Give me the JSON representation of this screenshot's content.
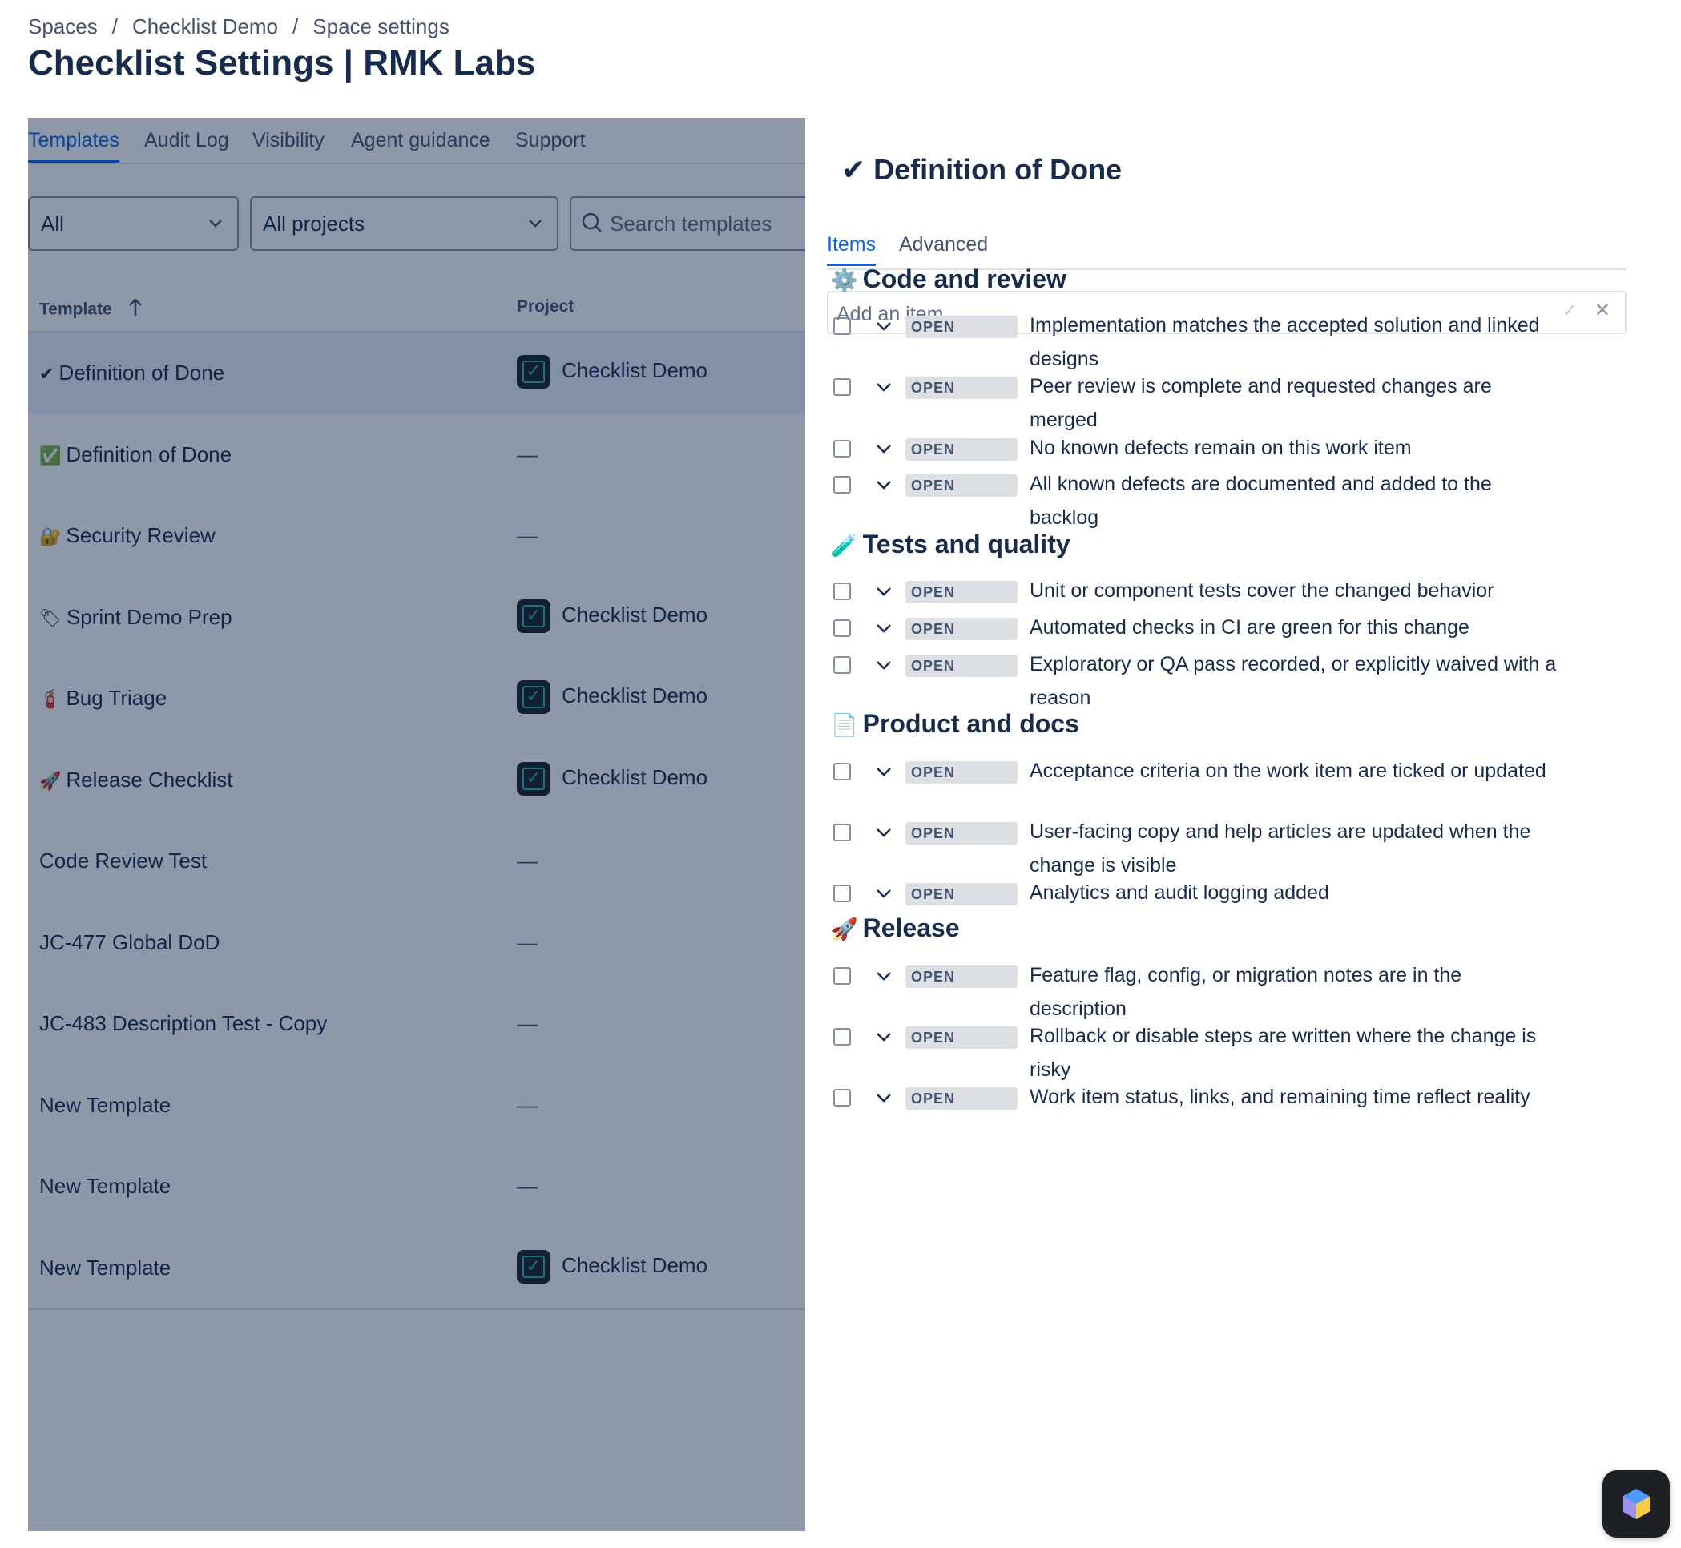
{
  "breadcrumb": {
    "items": [
      "Spaces",
      "Checklist Demo",
      "Space settings"
    ],
    "separator": "/"
  },
  "page": {
    "title": "Checklist Settings | RMK Labs"
  },
  "tabs": [
    "Templates",
    "Audit Log",
    "Visibility",
    "Agent guidance",
    "Support"
  ],
  "active_tab": "Templates",
  "filters": {
    "type_value": "All",
    "project_value": "All projects",
    "search_placeholder": "Search templates"
  },
  "table": {
    "columns": {
      "template": "Template",
      "project": "Project"
    },
    "sort_icon": "arrow-up-icon",
    "rows": [
      {
        "icon": "✔",
        "name": "Definition of Done",
        "project": "Checklist Demo",
        "selected": true
      },
      {
        "icon": "✅",
        "name": "Definition of Done",
        "project": "—"
      },
      {
        "icon": "🔐",
        "name": "Security Review",
        "project": "—"
      },
      {
        "icon": "🏷",
        "name": "Sprint Demo Prep",
        "project": "Checklist Demo"
      },
      {
        "icon": "🧯",
        "name": "Bug Triage",
        "project": "Checklist Demo"
      },
      {
        "icon": "🚀",
        "name": "Release Checklist",
        "project": "Checklist Demo"
      },
      {
        "icon": "",
        "name": "Code Review Test",
        "project": "—"
      },
      {
        "icon": "",
        "name": "JC-477 Global DoD",
        "project": "—"
      },
      {
        "icon": "",
        "name": "JC-483 Description Test - Copy",
        "project": "—"
      },
      {
        "icon": "",
        "name": "New Template",
        "project": "—"
      },
      {
        "icon": "",
        "name": "New Template",
        "project": "—"
      },
      {
        "icon": "",
        "name": "New Template",
        "project": "Checklist Demo"
      }
    ]
  },
  "drawer": {
    "title": "✔ Definition of Done",
    "tabs": [
      "Items",
      "Advanced"
    ],
    "active_tab": "Items",
    "add_item_placeholder": "Add an item",
    "add_confirm": "✓",
    "add_cancel": "✕",
    "status_label": "OPEN",
    "sections": [
      {
        "icon": "⚙️",
        "title": "Code and review",
        "items": [
          "Implementation matches the accepted solution and linked designs",
          "Peer review is complete and requested changes are merged",
          "No known defects remain on this work item",
          "All known defects are documented and added to the backlog"
        ]
      },
      {
        "icon": "🧪",
        "title": "Tests and quality",
        "items": [
          "Unit or component tests cover the changed behavior",
          "Automated checks in CI are green for this change",
          "Exploratory or QA pass recorded, or explicitly waived with a reason"
        ]
      },
      {
        "icon": "📄",
        "title": "Product and docs",
        "items": [
          "Acceptance criteria on the work item are ticked or updated",
          "User-facing copy and help articles are updated when the change is visible",
          "Analytics and audit logging added"
        ]
      },
      {
        "icon": "🚀",
        "title": "Release",
        "items": [
          "Feature flag, config, or migration notes are in the description",
          "Rollback or disable steps are written where the change is risky",
          "Work item status, links, and remaining time reflect reality"
        ]
      }
    ]
  },
  "colors": {
    "accent": "#0c66e4",
    "overlay": "#091e42",
    "text": "#172b4d",
    "lozenge": "#dcdfe4"
  },
  "fab_icon": "app-hexagon-icon"
}
